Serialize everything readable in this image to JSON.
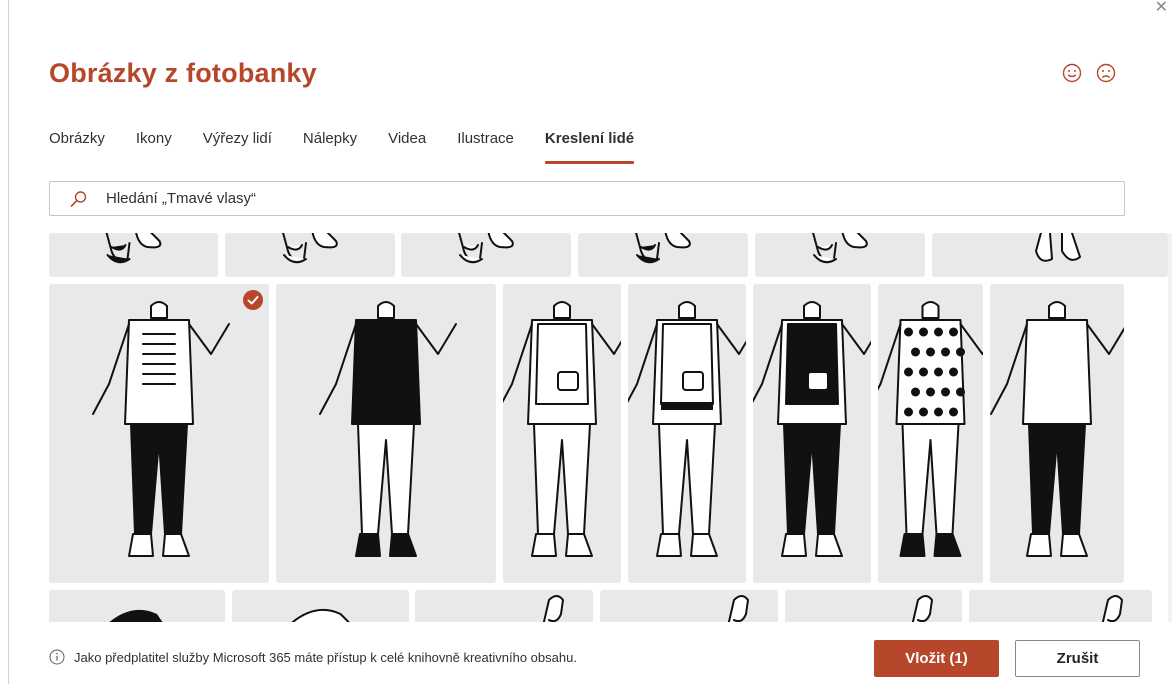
{
  "dialog": {
    "title": "Obrázky z fotobanky",
    "close_glyph": "✕"
  },
  "feedback": {
    "positive": "smile-icon",
    "negative": "frown-icon"
  },
  "tabs": [
    {
      "label": "Obrázky",
      "active": false
    },
    {
      "label": "Ikony",
      "active": false
    },
    {
      "label": "Výřezy lidí",
      "active": false
    },
    {
      "label": "Nálepky",
      "active": false
    },
    {
      "label": "Videa",
      "active": false
    },
    {
      "label": "Ilustrace",
      "active": false
    },
    {
      "label": "Kreslení lidé",
      "active": true
    }
  ],
  "search": {
    "placeholder": "Hledání „Tmavé vlasy“"
  },
  "grid": {
    "rows": [
      {
        "tiles": [
          {
            "kind": "shoes-dark",
            "selected": false
          },
          {
            "kind": "shoes-light",
            "selected": false
          },
          {
            "kind": "shoes-light",
            "selected": false
          },
          {
            "kind": "shoes-dark",
            "selected": false
          },
          {
            "kind": "shoes-light",
            "selected": false
          },
          {
            "kind": "boots",
            "selected": false
          }
        ]
      },
      {
        "tiles": [
          {
            "kind": "figure-stripe-darkpants",
            "selected": true
          },
          {
            "kind": "figure-darktop-lightpants",
            "selected": false
          },
          {
            "kind": "figure-vest-pointing",
            "selected": false
          },
          {
            "kind": "figure-vest-band-pointing",
            "selected": false
          },
          {
            "kind": "figure-darkvest-darkpants",
            "selected": false
          },
          {
            "kind": "figure-polka-dot",
            "selected": false
          },
          {
            "kind": "figure-sweater-darkpants",
            "selected": false
          }
        ]
      },
      {
        "tiles": [
          {
            "kind": "partial-dark-shoulder",
            "selected": false
          },
          {
            "kind": "partial-light-shoulder",
            "selected": false
          },
          {
            "kind": "partial-hand",
            "selected": false
          },
          {
            "kind": "partial-hand",
            "selected": false
          },
          {
            "kind": "partial-hand",
            "selected": false
          },
          {
            "kind": "partial-hand",
            "selected": false
          }
        ]
      }
    ]
  },
  "footer": {
    "info_text": "Jako předplatitel služby Microsoft 365 máte přístup k celé knihovně kreativního obsahu.",
    "insert_label": "Vložit (1)",
    "cancel_label": "Zrušit"
  },
  "colors": {
    "accent": "#b7472a",
    "tile_bg": "#e9e9e9",
    "border": "#c8c6c4"
  }
}
